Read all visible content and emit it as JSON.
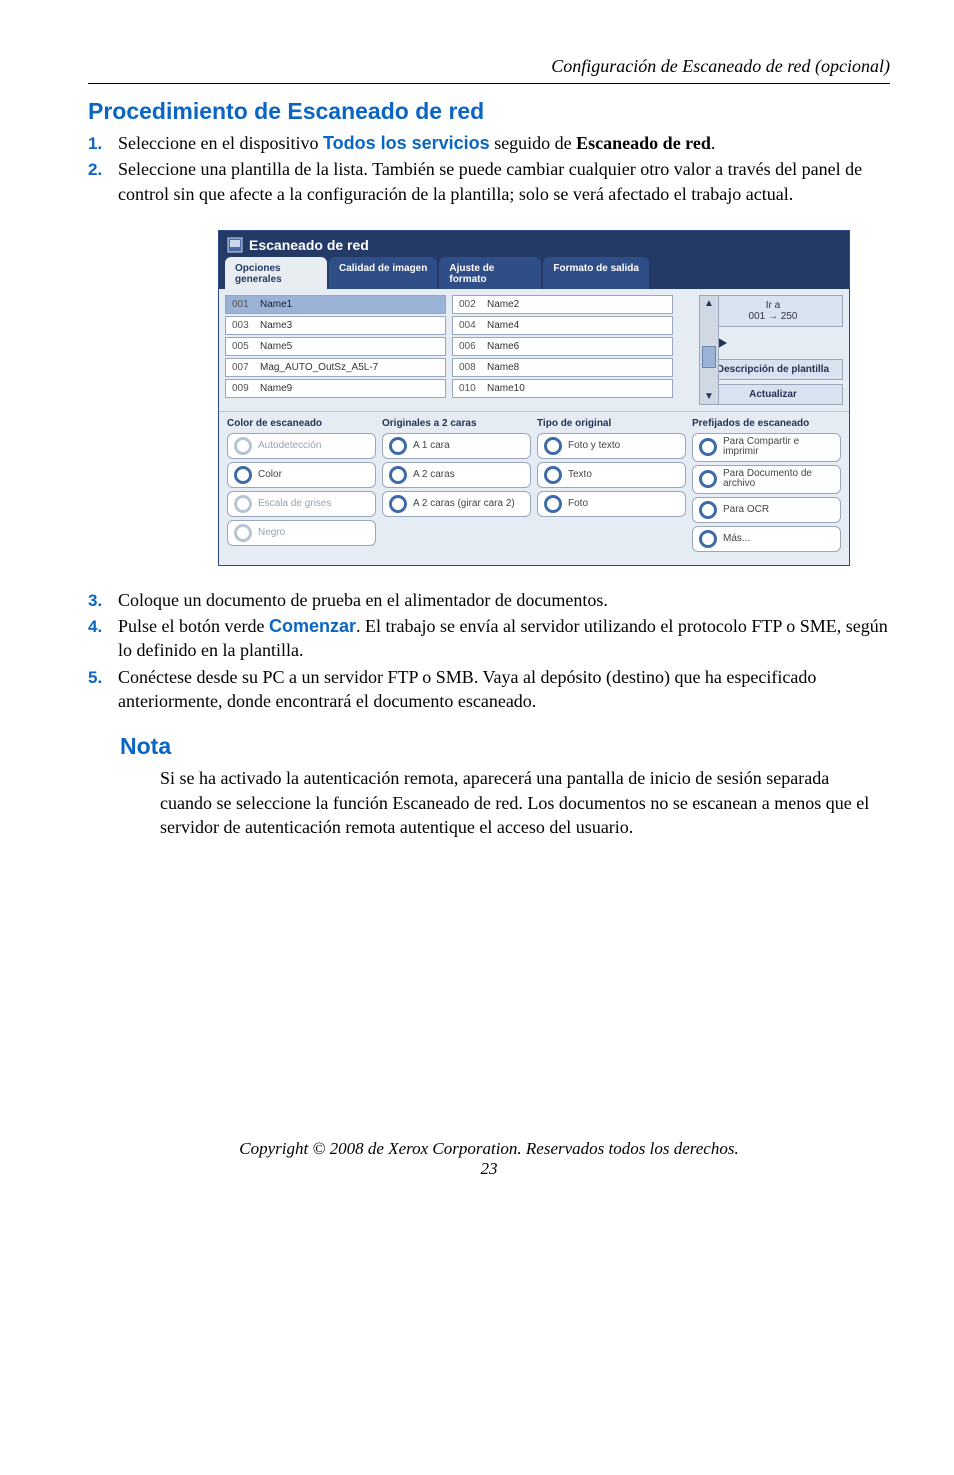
{
  "running_header": "Configuración de Escaneado de red (opcional)",
  "h1": "Procedimiento de Escaneado de red",
  "steps": [
    {
      "num": "1.",
      "pre": "Seleccione en el dispositivo ",
      "hl1": "Todos los servicios",
      "mid1": " seguido de ",
      "bold1": "Escaneado de red",
      "post1": "."
    },
    {
      "num": "2.",
      "text": "Seleccione una plantilla de la lista. También se puede cambiar cualquier otro valor a través del panel de control sin que afecte a la configuración de la plantilla; solo se verá afectado el trabajo actual."
    },
    {
      "num": "3.",
      "text": "Coloque un documento de prueba en el alimentador de documentos."
    },
    {
      "num": "4.",
      "pre": "Pulse el botón verde ",
      "hl1": "Comenzar",
      "post1": ". El trabajo se envía al servidor utilizando el protocolo FTP o SME, según lo definido en la plantilla."
    },
    {
      "num": "5.",
      "text": "Conéctese desde su PC a un servidor FTP o SMB. Vaya al depósito (destino) que ha especificado anteriormente, donde encontrará el documento escaneado."
    }
  ],
  "figure": {
    "title": "Escaneado de red",
    "tabs": [
      {
        "label": "Opciones\ngenerales",
        "active": true
      },
      {
        "label": "Calidad de imagen",
        "active": false
      },
      {
        "label": "Ajuste de\nformato",
        "active": false
      },
      {
        "label": "Formato de salida",
        "active": false
      }
    ],
    "templates": [
      {
        "id": "001",
        "name": "Name1",
        "selected": true
      },
      {
        "id": "002",
        "name": "Name2"
      },
      {
        "id": "003",
        "name": "Name3"
      },
      {
        "id": "004",
        "name": "Name4"
      },
      {
        "id": "005",
        "name": "Name5"
      },
      {
        "id": "006",
        "name": "Name6"
      },
      {
        "id": "007",
        "name": "Mag_AUTO_OutSz_A5L-7"
      },
      {
        "id": "008",
        "name": "Name8"
      },
      {
        "id": "009",
        "name": "Name9"
      },
      {
        "id": "010",
        "name": "Name10"
      }
    ],
    "go_line1": "Ir a",
    "go_line2": "001 → 250",
    "btn_desc": "Descripción de plantilla",
    "btn_update": "Actualizar",
    "option_cols": [
      {
        "title": "Color de escaneado",
        "items": [
          {
            "label": "Autodetección",
            "dim": true
          },
          {
            "label": "Color"
          },
          {
            "label": "Escala de grises",
            "dim": true
          },
          {
            "label": "Negro",
            "dim": true
          }
        ]
      },
      {
        "title": "Originales a 2 caras",
        "items": [
          {
            "label": "A 1 cara"
          },
          {
            "label": "A 2 caras"
          },
          {
            "label": "A 2 caras (girar cara 2)"
          }
        ]
      },
      {
        "title": "Tipo de original",
        "items": [
          {
            "label": "Foto y texto"
          },
          {
            "label": "Texto"
          },
          {
            "label": "Foto"
          }
        ]
      },
      {
        "title": "Prefijados de escaneado",
        "items": [
          {
            "label": "Para Compartir e imprimir"
          },
          {
            "label": "Para Documento de archivo"
          },
          {
            "label": "Para OCR"
          },
          {
            "label": "Más..."
          }
        ]
      }
    ]
  },
  "note_title": "Nota",
  "note_body": "Si se ha activado la autenticación remota, aparecerá una pantalla de inicio de sesión separada cuando se seleccione la función Escaneado de red. Los documentos no se escanean a menos que el servidor de autenticación remota autentique el acceso del usuario.",
  "footer": "Copyright © 2008 de Xerox Corporation. Reservados todos los derechos.",
  "page_number": "23"
}
